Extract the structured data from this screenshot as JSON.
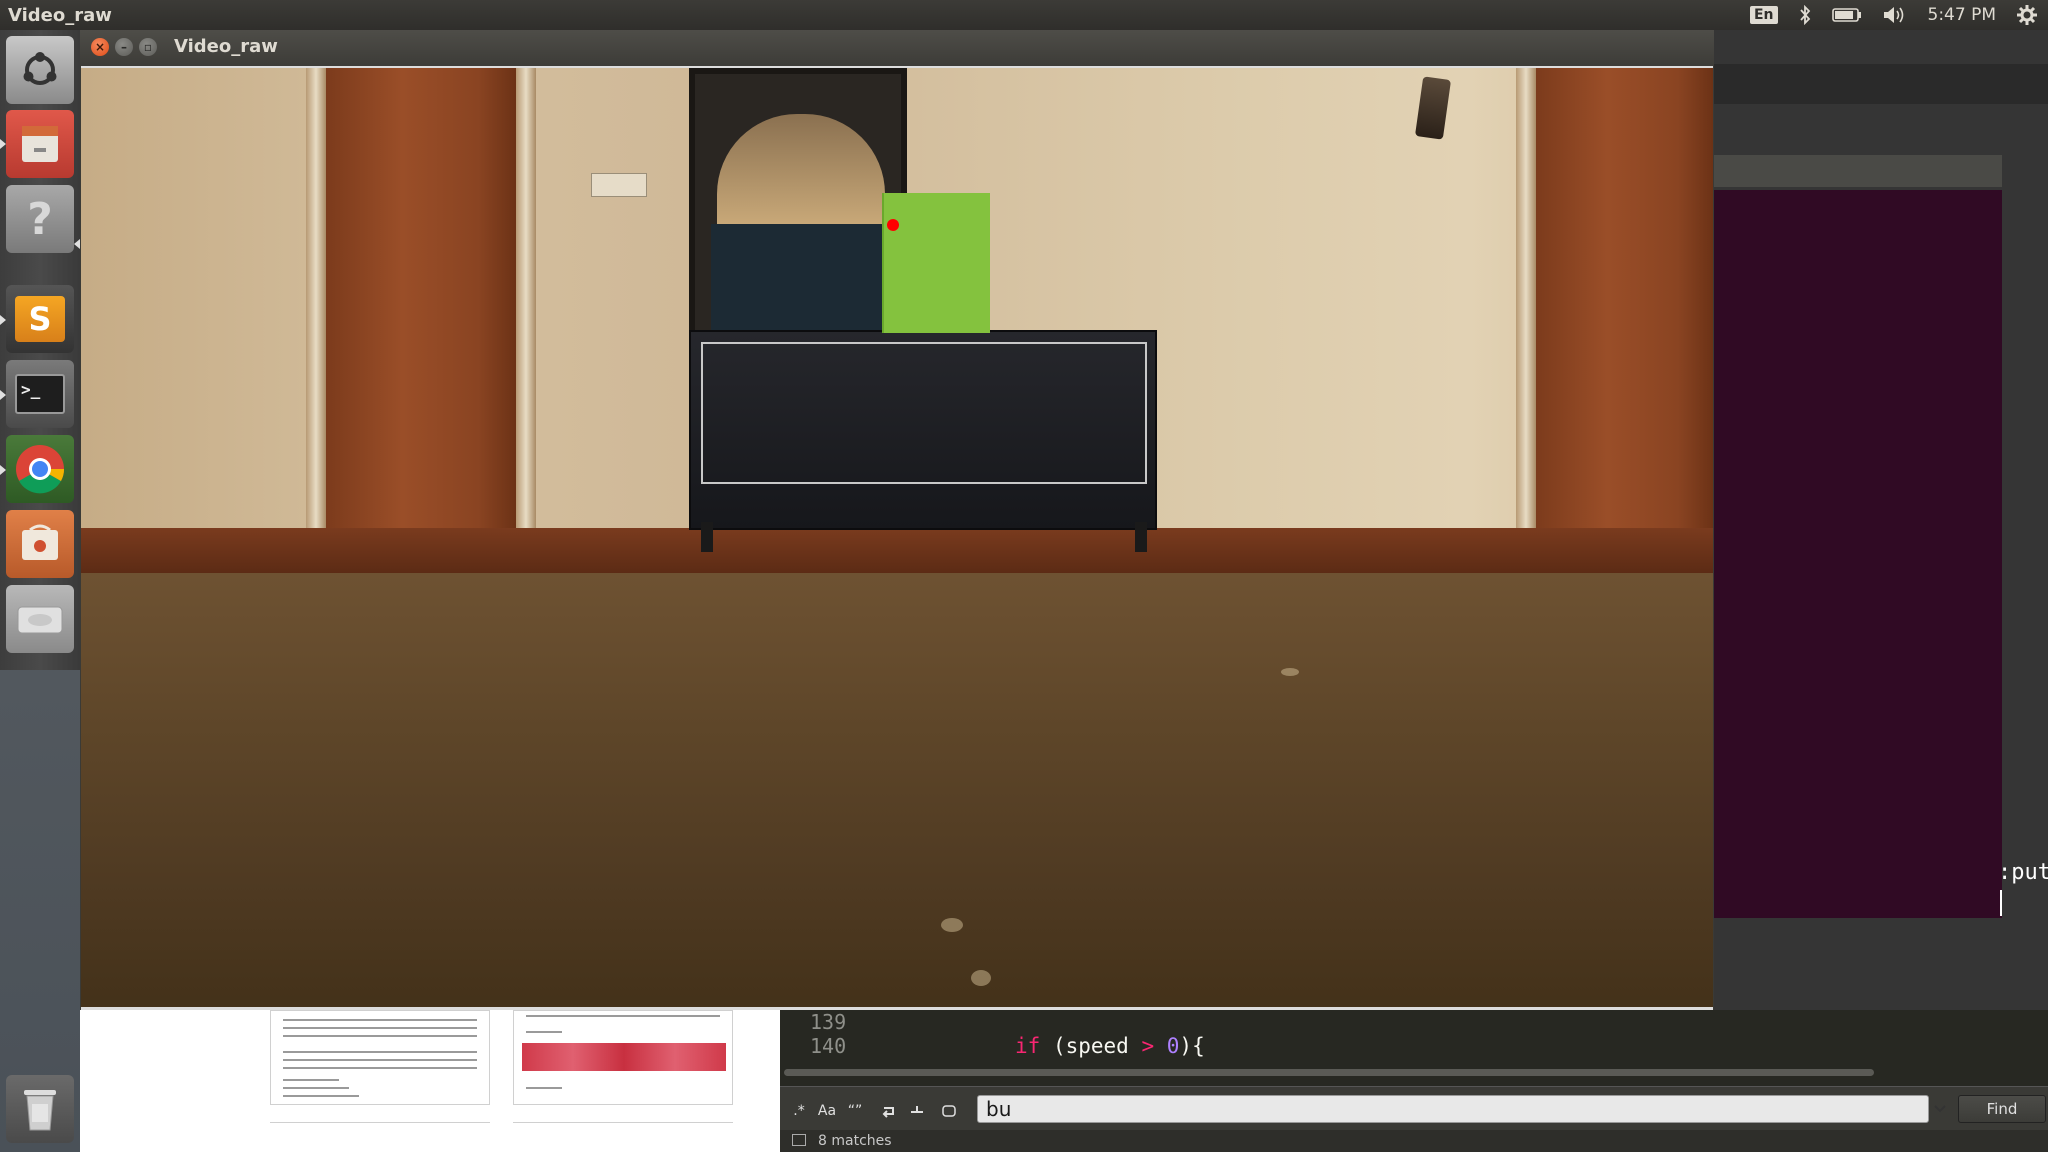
{
  "top_panel": {
    "app_title": "Video_raw",
    "keyboard_layout": "En",
    "clock": "5:47 PM"
  },
  "launcher": {
    "items": [
      {
        "name": "Dash",
        "icon": "ubuntu-logo-icon"
      },
      {
        "name": "Files",
        "icon": "file-cabinet-icon"
      },
      {
        "name": "Help",
        "icon": "question-mark-icon",
        "label": "?"
      },
      {
        "name": "Sublime Text",
        "icon": "sublime-icon",
        "label": "S"
      },
      {
        "name": "Terminal",
        "icon": "terminal-icon",
        "label": ">_"
      },
      {
        "name": "Google Chrome",
        "icon": "chrome-icon"
      },
      {
        "name": "Software Center",
        "icon": "software-center-icon"
      },
      {
        "name": "Disk",
        "icon": "disk-icon"
      },
      {
        "name": "Trash",
        "icon": "trash-icon"
      }
    ]
  },
  "video_window": {
    "title": "Video_raw",
    "overlay": {
      "box_color": "#84c23e",
      "dot_color": "#ff0000"
    }
  },
  "terminal": {
    "visible_text": ":put"
  },
  "editor": {
    "lines": [
      {
        "number": "139",
        "code": ""
      },
      {
        "number": "140",
        "keyword": "if",
        "pre": " (speed ",
        "op": ">",
        "space": " ",
        "num": "0",
        "post": "){"
      }
    ],
    "find_bar": {
      "query": "bu",
      "button_label": "Find",
      "options": [
        ".*",
        "Aa",
        "“”"
      ]
    },
    "status": "8 matches"
  }
}
